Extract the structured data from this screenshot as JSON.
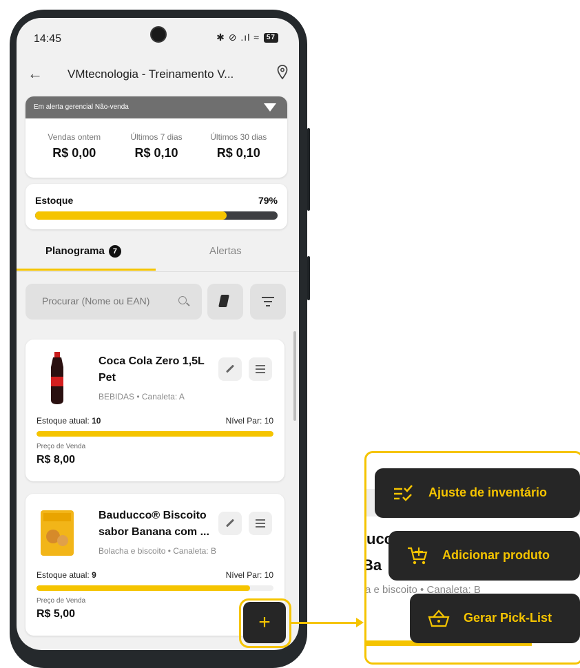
{
  "status_bar": {
    "time": "14:45",
    "icons": "✱ ⊘ .ıl ≈",
    "battery": "57"
  },
  "app_bar": {
    "title": "VMtecnologia - Treinamento V..."
  },
  "alert": {
    "banner": "Em alerta gerencial Não-venda",
    "stats": [
      {
        "label": "Vendas ontem",
        "value": "R$ 0,00"
      },
      {
        "label": "Últimos 7 dias",
        "value": "R$ 0,10"
      },
      {
        "label": "Últimos 30 dias",
        "value": "R$ 0,10"
      }
    ]
  },
  "stock": {
    "label": "Estoque",
    "percent_text": "79%",
    "fill_fraction": 0.79
  },
  "tabs": {
    "planograma": "Planograma",
    "badge": "7",
    "alertas": "Alertas"
  },
  "search": {
    "placeholder": "Procurar (Nome ou EAN)"
  },
  "products": [
    {
      "name": "Coca Cola Zero 1,5L Pet",
      "category": "BEBIDAS • Canaleta: A",
      "stock_label": "Estoque atual:",
      "stock_value": "10",
      "par_level": "Nível Par: 10",
      "fill_fraction": 1.0,
      "price_label": "Preço de Venda",
      "price": "R$ 8,00"
    },
    {
      "name": "Bauducco® Biscoito sabor Banana com ...",
      "category": "Bolacha e biscoito • Canaleta: B",
      "stock_label": "Estoque atual:",
      "stock_value": "9",
      "par_level": "Nível Par: 10",
      "fill_fraction": 0.9,
      "price_label": "Preço de Venda",
      "price": "R$ 5,00"
    }
  ],
  "fab": {
    "symbol": "+"
  },
  "zoom_background": {
    "line1": "ucc",
    "line2": "Ba",
    "line3": "a e biscoito • Canaleta: B"
  },
  "fab_menu": [
    {
      "label": "Ajuste de inventário",
      "icon": "checklist-icon"
    },
    {
      "label": "Adicionar produto",
      "icon": "cart-plus-icon"
    },
    {
      "label": "Gerar Pick-List",
      "icon": "basket-icon"
    }
  ],
  "colors": {
    "accent": "#f5c400",
    "dark": "#262626",
    "banner": "#6f6f6f"
  }
}
